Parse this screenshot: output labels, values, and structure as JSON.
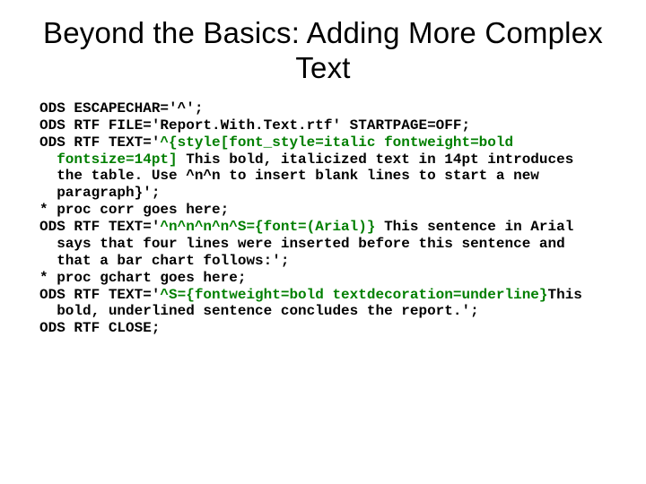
{
  "title": "Beyond the Basics: Adding More Complex Text",
  "code": {
    "l1": "ODS ESCAPECHAR='^';",
    "l2": "ODS RTF FILE='Report.With.Text.rtf' STARTPAGE=OFF;",
    "l3a": "ODS RTF TEXT='",
    "l3b": "^{style[font_style=italic fontweight=bold fontsize=14pt]",
    "l3c": " This bold, italicized text in 14pt introduces the table. Use ^n^n to insert blank lines to start a new paragraph}",
    "l3d": "';",
    "l4": "* proc corr goes here;",
    "l5a": "ODS RTF TEXT='",
    "l5b": "^n^n^n^n",
    "l5c": "^S={font=(Arial)}",
    "l5d": " This sentence in Arial says that four lines were inserted before this sentence and that a bar chart follows:",
    "l5e": "';",
    "l6": "* proc gchart goes here;",
    "l7a": "ODS RTF TEXT='",
    "l7b": "^S={fontweight=bold textdecoration=underline}",
    "l7c": "This bold, underlined sentence concludes the report.",
    "l7d": "';",
    "l8": "ODS RTF CLOSE;"
  }
}
